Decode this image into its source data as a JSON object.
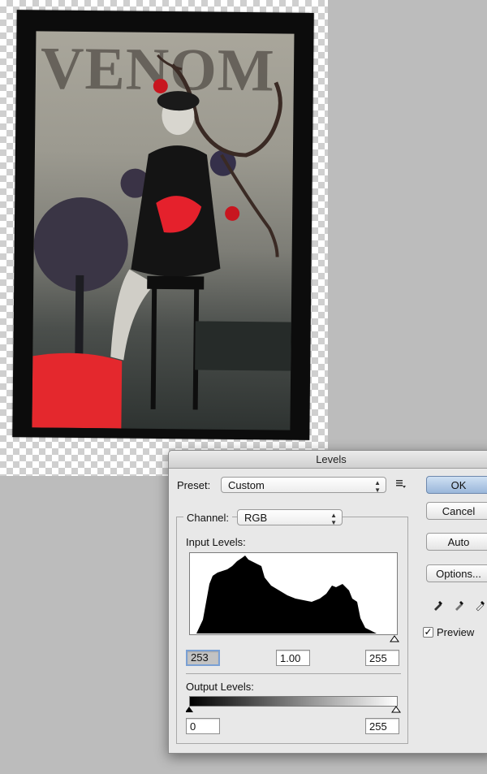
{
  "artwork": {
    "title_text": "VENOM"
  },
  "dialog": {
    "title": "Levels",
    "preset": {
      "label": "Preset:",
      "value": "Custom"
    },
    "channel": {
      "label": "Channel:",
      "value": "RGB"
    },
    "input_levels": {
      "label": "Input Levels:",
      "black": "253",
      "gamma": "1.00",
      "white": "255"
    },
    "output_levels": {
      "label": "Output Levels:",
      "black": "0",
      "white": "255"
    },
    "buttons": {
      "ok": "OK",
      "cancel": "Cancel",
      "auto": "Auto",
      "options": "Options..."
    },
    "preview": {
      "label": "Preview",
      "checked": true
    }
  },
  "colors": {
    "default_button": "#a8c2e3",
    "accent_red": "#e8202c"
  }
}
